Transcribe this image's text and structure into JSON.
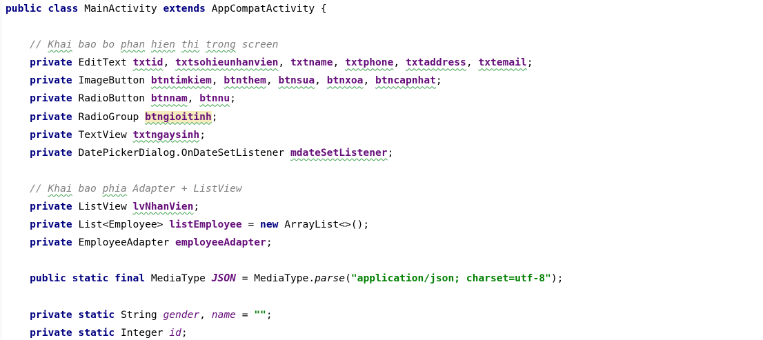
{
  "editor": {
    "lines": [
      {
        "tokens": [
          {
            "t": "public class",
            "c": "kw"
          },
          {
            "t": " MainActivity ",
            "c": ""
          },
          {
            "t": "extends",
            "c": "kw"
          },
          {
            "t": " AppCompatActivity {",
            "c": ""
          }
        ]
      },
      {
        "tokens": []
      },
      {
        "tokens": [
          {
            "t": "    // ",
            "c": "cmt"
          },
          {
            "t": "Khai",
            "c": "cmt typo"
          },
          {
            "t": " bao bo ",
            "c": "cmt"
          },
          {
            "t": "phan",
            "c": "cmt typo"
          },
          {
            "t": " ",
            "c": "cmt"
          },
          {
            "t": "hien",
            "c": "cmt typo"
          },
          {
            "t": " ",
            "c": "cmt"
          },
          {
            "t": "thi",
            "c": "cmt typo"
          },
          {
            "t": " ",
            "c": "cmt"
          },
          {
            "t": "trong",
            "c": "cmt typo"
          },
          {
            "t": " screen",
            "c": "cmt"
          }
        ]
      },
      {
        "tokens": [
          {
            "t": "    private",
            "c": "kw"
          },
          {
            "t": " EditText ",
            "c": ""
          },
          {
            "t": "txtid",
            "c": "field typo"
          },
          {
            "t": ", ",
            "c": ""
          },
          {
            "t": "txtsohieunhanvien",
            "c": "field typo"
          },
          {
            "t": ", ",
            "c": ""
          },
          {
            "t": "txtname",
            "c": "field"
          },
          {
            "t": ", ",
            "c": ""
          },
          {
            "t": "txtphone",
            "c": "field typo"
          },
          {
            "t": ", ",
            "c": ""
          },
          {
            "t": "txtaddress",
            "c": "field typo"
          },
          {
            "t": ", ",
            "c": ""
          },
          {
            "t": "txtemail",
            "c": "field typo"
          },
          {
            "t": ";",
            "c": ""
          }
        ]
      },
      {
        "tokens": [
          {
            "t": "    private",
            "c": "kw"
          },
          {
            "t": " ImageButton ",
            "c": ""
          },
          {
            "t": "btntimkiem",
            "c": "field typo"
          },
          {
            "t": ", ",
            "c": ""
          },
          {
            "t": "btnthem",
            "c": "field typo"
          },
          {
            "t": ", ",
            "c": ""
          },
          {
            "t": "btnsua",
            "c": "field typo"
          },
          {
            "t": ", ",
            "c": ""
          },
          {
            "t": "btnxoa",
            "c": "field typo"
          },
          {
            "t": ", ",
            "c": ""
          },
          {
            "t": "btncapnhat",
            "c": "field typo"
          },
          {
            "t": ";",
            "c": ""
          }
        ]
      },
      {
        "tokens": [
          {
            "t": "    private",
            "c": "kw"
          },
          {
            "t": " RadioButton ",
            "c": ""
          },
          {
            "t": "btnnam",
            "c": "field typo"
          },
          {
            "t": ", ",
            "c": ""
          },
          {
            "t": "btnnu",
            "c": "field typo"
          },
          {
            "t": ";",
            "c": ""
          }
        ]
      },
      {
        "tokens": [
          {
            "t": "    private",
            "c": "kw"
          },
          {
            "t": " RadioGroup ",
            "c": ""
          },
          {
            "t": "btngioitinh",
            "c": "field typo hl"
          },
          {
            "t": ";",
            "c": ""
          }
        ]
      },
      {
        "tokens": [
          {
            "t": "    private",
            "c": "kw"
          },
          {
            "t": " TextView ",
            "c": ""
          },
          {
            "t": "txtngaysinh",
            "c": "field typo"
          },
          {
            "t": ";",
            "c": ""
          }
        ]
      },
      {
        "tokens": [
          {
            "t": "    private",
            "c": "kw"
          },
          {
            "t": " DatePickerDialog.OnDateSetListener ",
            "c": ""
          },
          {
            "t": "mdateSetListener",
            "c": "field typo"
          },
          {
            "t": ";",
            "c": ""
          }
        ]
      },
      {
        "tokens": []
      },
      {
        "tokens": [
          {
            "t": "    // ",
            "c": "cmt"
          },
          {
            "t": "Khai",
            "c": "cmt typo"
          },
          {
            "t": " bao ",
            "c": "cmt"
          },
          {
            "t": "phia",
            "c": "cmt typo"
          },
          {
            "t": " Adapter + ListView",
            "c": "cmt"
          }
        ]
      },
      {
        "tokens": [
          {
            "t": "    private",
            "c": "kw"
          },
          {
            "t": " ListView ",
            "c": ""
          },
          {
            "t": "lvNhanVien",
            "c": "field typo"
          },
          {
            "t": ";",
            "c": ""
          }
        ]
      },
      {
        "tokens": [
          {
            "t": "    private",
            "c": "kw"
          },
          {
            "t": " List<Employee> ",
            "c": ""
          },
          {
            "t": "listEmployee",
            "c": "field"
          },
          {
            "t": " = ",
            "c": ""
          },
          {
            "t": "new",
            "c": "kw"
          },
          {
            "t": " ArrayList<>();",
            "c": ""
          }
        ]
      },
      {
        "tokens": [
          {
            "t": "    private",
            "c": "kw"
          },
          {
            "t": " EmployeeAdapter ",
            "c": ""
          },
          {
            "t": "employeeAdapter",
            "c": "field"
          },
          {
            "t": ";",
            "c": ""
          }
        ]
      },
      {
        "tokens": []
      },
      {
        "tokens": [
          {
            "t": "    public static final",
            "c": "kw"
          },
          {
            "t": " MediaType ",
            "c": ""
          },
          {
            "t": "JSON",
            "c": "staticf-b"
          },
          {
            "t": " = MediaType.",
            "c": ""
          },
          {
            "t": "parse",
            "c": "method"
          },
          {
            "t": "(",
            "c": ""
          },
          {
            "t": "\"application/json; charset=utf-8\"",
            "c": "str"
          },
          {
            "t": ");",
            "c": ""
          }
        ]
      },
      {
        "tokens": []
      },
      {
        "tokens": [
          {
            "t": "    private static",
            "c": "kw"
          },
          {
            "t": " String ",
            "c": ""
          },
          {
            "t": "gender",
            "c": "staticf"
          },
          {
            "t": ", ",
            "c": ""
          },
          {
            "t": "name",
            "c": "staticf"
          },
          {
            "t": " = ",
            "c": ""
          },
          {
            "t": "\"\"",
            "c": "str"
          },
          {
            "t": ";",
            "c": ""
          }
        ]
      },
      {
        "tokens": [
          {
            "t": "    private static",
            "c": "kw"
          },
          {
            "t": " Integer ",
            "c": ""
          },
          {
            "t": "id",
            "c": "staticf"
          },
          {
            "t": ";",
            "c": ""
          }
        ]
      }
    ]
  }
}
